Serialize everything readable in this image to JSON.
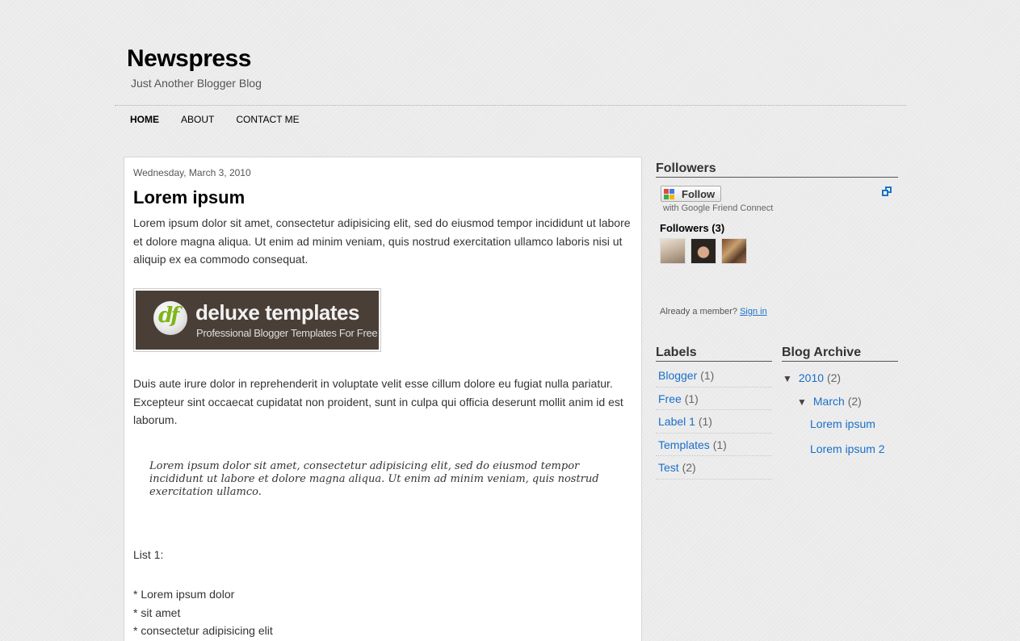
{
  "header": {
    "title": "Newspress",
    "description": "Just Another Blogger Blog"
  },
  "nav": {
    "items": [
      "HOME",
      "ABOUT",
      "CONTACT ME"
    ],
    "active": "HOME"
  },
  "post": {
    "date": "Wednesday, March 3, 2010",
    "title": "Lorem ipsum",
    "paragraph1": "Lorem ipsum dolor sit amet, consectetur adipisicing elit, sed do eiusmod tempor incididunt ut labore et dolore magna aliqua. Ut enim ad minim veniam, quis nostrud exercitation ullamco laboris nisi ut aliquip ex ea commodo consequat.",
    "banner": {
      "logo_text": "df",
      "name": "deluxe templates",
      "tagline": "Professional Blogger Templates For Free"
    },
    "paragraph2": "Duis aute irure dolor in reprehenderit in voluptate velit esse cillum dolore eu fugiat nulla pariatur. Excepteur sint occaecat cupidatat non proident, sunt in culpa qui officia deserunt mollit anim id est laborum.",
    "blockquote": "Lorem ipsum dolor sit amet, consectetur adipisicing elit, sed do eiusmod tempor incididunt ut labore et dolore magna aliqua. Ut enim ad minim veniam, quis nostrud exercitation ullamco.",
    "list_title": "List 1:",
    "list_items": [
      "* Lorem ipsum dolor",
      "* sit amet",
      "* consectetur adipisicing elit"
    ]
  },
  "sidebar": {
    "followers": {
      "title": "Followers",
      "follow_button": "Follow",
      "gfc_note": "with Google Friend Connect",
      "count_label": "Followers (3)",
      "already_member": "Already a member?",
      "sign_in": "Sign in"
    },
    "labels": {
      "title": "Labels",
      "items": [
        {
          "name": "Blogger",
          "count": "(1)"
        },
        {
          "name": "Free",
          "count": "(1)"
        },
        {
          "name": "Label 1",
          "count": "(1)"
        },
        {
          "name": "Templates",
          "count": "(1)"
        },
        {
          "name": "Test",
          "count": "(2)"
        }
      ]
    },
    "archive": {
      "title": "Blog Archive",
      "year": "2010",
      "year_count": "(2)",
      "month": "March",
      "month_count": "(2)",
      "posts": [
        "Lorem ipsum",
        "Lorem ipsum 2"
      ]
    }
  },
  "colors": {
    "link": "#1a6fc9",
    "background": "#ececec",
    "post_background": "#ffffff"
  }
}
